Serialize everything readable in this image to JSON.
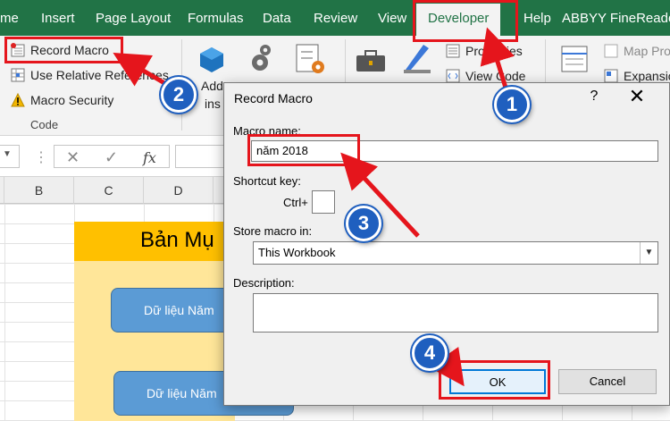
{
  "ribbon_tabs": [
    "me",
    "Insert",
    "Page Layout",
    "Formulas",
    "Data",
    "Review",
    "View",
    "Developer",
    "Help",
    "ABBYY FineReader"
  ],
  "code_group": {
    "record_macro": "Record Macro",
    "use_relative": "Use Relative References",
    "macro_security": "Macro Security",
    "label": "Code"
  },
  "addins_partial": [
    "Add",
    "ins"
  ],
  "controls_partial": [
    "Properties",
    "View Code"
  ],
  "xml_partial": [
    "Map Pro",
    "Expansio"
  ],
  "formula_bar": {
    "fx": "fx",
    "cancel": "✕",
    "enter": "✓"
  },
  "columns": [
    "B",
    "C",
    "D"
  ],
  "sheet": {
    "title": "Bản Mụ",
    "buttons": [
      "Dữ liệu Năm",
      "Dữ liệu Năm"
    ]
  },
  "dialog": {
    "title": "Record Macro",
    "help": "?",
    "close": "✕",
    "macro_name_label": "Macro name:",
    "macro_name_value": "năm 2018",
    "shortcut_label": "Shortcut key:",
    "ctrl_label": "Ctrl+",
    "shortcut_value": "",
    "store_label": "Store macro in:",
    "store_value": "This Workbook",
    "description_label": "Description:",
    "description_value": "",
    "ok": "OK",
    "cancel": "Cancel"
  },
  "annotations": [
    "1",
    "2",
    "3",
    "4"
  ],
  "colors": {
    "excel_green": "#217346",
    "annotation_red": "#e5151c",
    "badge_blue": "#1f5fbf",
    "title_yellow": "#ffc000"
  }
}
